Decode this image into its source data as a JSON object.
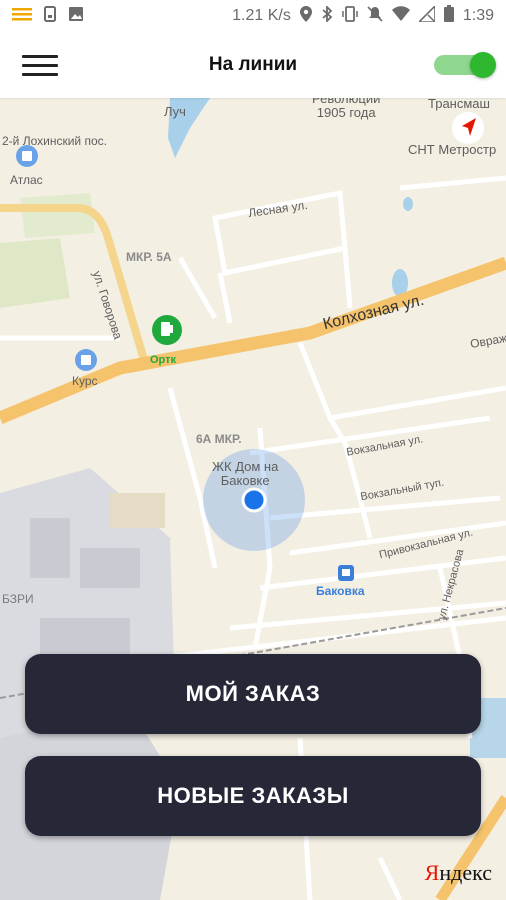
{
  "status_bar": {
    "speed": "1.21 K/s",
    "time": "1:39",
    "icons": [
      "menu-notification-icon",
      "sim-icon",
      "image-icon",
      "location-icon",
      "bluetooth-icon",
      "vibrate-icon",
      "mute-icon",
      "wifi-icon",
      "no-signal-icon",
      "battery-icon"
    ]
  },
  "app_bar": {
    "title": "На линии",
    "online_toggle": true,
    "accent_color": "#2fb82f"
  },
  "map": {
    "labels": {
      "luch": "Луч",
      "revolution": "Революции\n1905 года",
      "transmash": "Трансмаш",
      "snt": "СНТ Метростр",
      "lokhinsky": "2-й Лохинский пос.",
      "atlas": "Атлас",
      "lesnaya": "Лесная ул.",
      "mkr5a": "МКР. 5А",
      "govorova": "ул. Говорова",
      "kolkhoznaya": "Колхозная ул.",
      "ovrazh": "Овраж",
      "ortk": "Ортк",
      "kurs": "Курс",
      "mkr6a": "6А МКР.",
      "zhk": "ЖК Дом на\nБаковке",
      "vokzalnaya": "Вокзальная ул.",
      "vokzalny": "Вокзальный туп.",
      "privokzalnaya": "Привокзальная ул.",
      "bakovka": "Баковка",
      "bzri": "БЗРИ",
      "nekrasova": "ул. Некрасова",
      "yandex_ya": "Я",
      "yandex_rest": "ндекс"
    }
  },
  "buttons": {
    "my_order": "МОЙ ЗАКАЗ",
    "new_orders": "НОВЫЕ ЗАКАЗЫ"
  },
  "colors": {
    "button_bg": "#262837",
    "road_major": "#f5c36c",
    "location_dot": "#1a73e8"
  }
}
